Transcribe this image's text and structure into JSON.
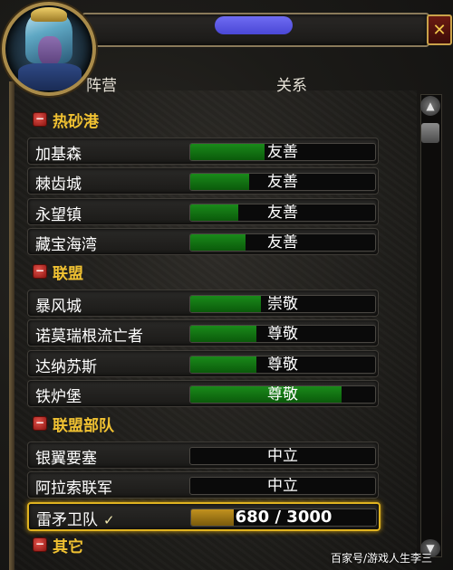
{
  "window": {
    "close_label": "✕"
  },
  "headers": {
    "faction": "阵营",
    "relation": "关系"
  },
  "groups": [
    {
      "name": "热砂港",
      "factions": [
        {
          "name": "加基森",
          "standing": "友善",
          "progress": 0.4,
          "color": "green"
        },
        {
          "name": "棘齿城",
          "standing": "友善",
          "progress": 0.32,
          "color": "green"
        },
        {
          "name": "永望镇",
          "standing": "友善",
          "progress": 0.26,
          "color": "green"
        },
        {
          "name": "藏宝海湾",
          "standing": "友善",
          "progress": 0.3,
          "color": "green"
        }
      ]
    },
    {
      "name": "联盟",
      "factions": [
        {
          "name": "暴风城",
          "standing": "崇敬",
          "progress": 0.38,
          "color": "green"
        },
        {
          "name": "诺莫瑞根流亡者",
          "standing": "尊敬",
          "progress": 0.36,
          "color": "green"
        },
        {
          "name": "达纳苏斯",
          "standing": "尊敬",
          "progress": 0.36,
          "color": "green"
        },
        {
          "name": "铁炉堡",
          "standing": "尊敬",
          "progress": 0.82,
          "color": "green"
        }
      ]
    },
    {
      "name": "联盟部队",
      "factions": [
        {
          "name": "银翼要塞",
          "standing": "中立",
          "progress": 0.0,
          "color": "green"
        },
        {
          "name": "阿拉索联军",
          "standing": "中立",
          "progress": 0.0,
          "color": "green"
        },
        {
          "name": "雷矛卫队",
          "standing": "680 / 3000",
          "progress": 0.23,
          "color": "gold",
          "selected": true,
          "check": "✓"
        }
      ]
    },
    {
      "name": "其它",
      "factions": []
    }
  ],
  "icons": {
    "collapse": "−",
    "scroll_up": "▲",
    "scroll_down": "▼"
  },
  "colors": {
    "group_label": "#f1c232",
    "bar_green": "#1a8a1a",
    "bar_gold": "#c2921f",
    "selected_border": "#e0b320",
    "title_pill": "#5e5be8"
  },
  "watermark": "百家号/游戏人生李三"
}
